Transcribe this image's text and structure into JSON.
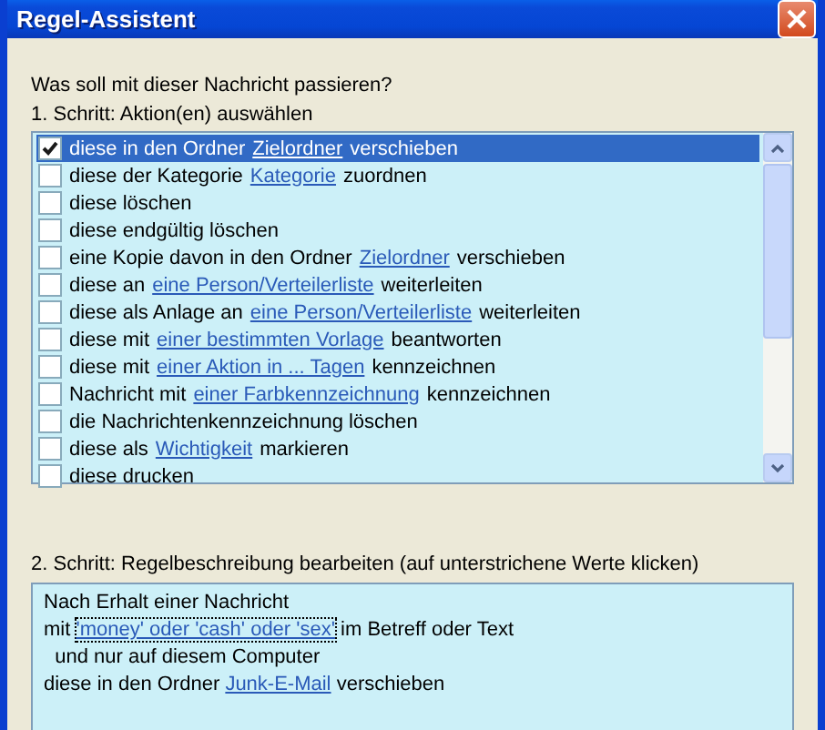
{
  "window": {
    "title": "Regel-Assistent"
  },
  "question": "Was soll mit dieser Nachricht passieren?",
  "step1": {
    "label": "1. Schritt: Aktion(en) auswählen",
    "actions": [
      {
        "checked": true,
        "selected": true,
        "text": "diese in den Ordner",
        "link": "Zielordner",
        "after": "verschieben"
      },
      {
        "checked": false,
        "selected": false,
        "text": "diese der Kategorie",
        "link": "Kategorie",
        "after": "zuordnen"
      },
      {
        "checked": false,
        "selected": false,
        "text": "diese löschen"
      },
      {
        "checked": false,
        "selected": false,
        "text": "diese endgültig löschen"
      },
      {
        "checked": false,
        "selected": false,
        "text": "eine Kopie davon in den Ordner",
        "link": "Zielordner",
        "after": "verschieben"
      },
      {
        "checked": false,
        "selected": false,
        "text": "diese an",
        "link": "eine Person/Verteilerliste",
        "after": "weiterleiten"
      },
      {
        "checked": false,
        "selected": false,
        "text": "diese als Anlage an",
        "link": "eine Person/Verteilerliste",
        "after": "weiterleiten"
      },
      {
        "checked": false,
        "selected": false,
        "text": "diese mit",
        "link": "einer bestimmten Vorlage",
        "after": "beantworten"
      },
      {
        "checked": false,
        "selected": false,
        "text": "diese mit",
        "link": "einer Aktion in ... Tagen",
        "after": "kennzeichnen"
      },
      {
        "checked": false,
        "selected": false,
        "text": "Nachricht mit",
        "link": "einer Farbkennzeichnung",
        "after": "kennzeichnen"
      },
      {
        "checked": false,
        "selected": false,
        "text": "die Nachrichtenkennzeichnung löschen"
      },
      {
        "checked": false,
        "selected": false,
        "text": "diese als",
        "link": "Wichtigkeit",
        "after": "markieren"
      },
      {
        "checked": false,
        "selected": false,
        "text": "diese drucken"
      }
    ]
  },
  "step2": {
    "label": "2. Schritt: Regelbeschreibung bearbeiten (auf unterstrichene Werte klicken)",
    "lines": [
      {
        "text": "Nach Erhalt einer Nachricht"
      },
      {
        "text": "mit",
        "link": "'money' oder 'cash' oder 'sex'",
        "focused": true,
        "after": "im Betreff oder Text"
      },
      {
        "text": "  und nur auf diesem Computer"
      },
      {
        "text": "diese in den Ordner",
        "link": "Junk-E-Mail",
        "focused": false,
        "after": "verschieben"
      }
    ]
  }
}
